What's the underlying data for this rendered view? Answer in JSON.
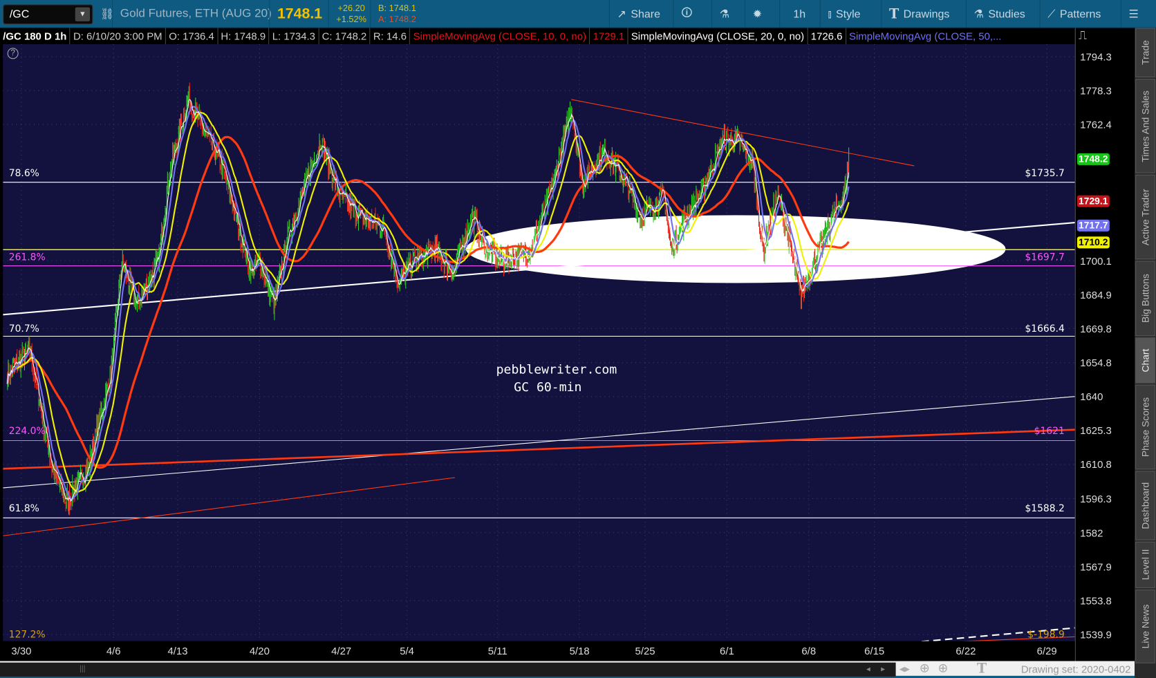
{
  "toolbar": {
    "symbol": "/GC",
    "description": "Gold Futures, ETH (AUG 20)",
    "last": "1748.1",
    "change": "+26.20",
    "change_pct": "+1.52%",
    "bid": "B: 1748.1",
    "ask": "A: 1748.2",
    "share": "Share",
    "timeframe": "1h",
    "style": "Style",
    "drawings": "Drawings",
    "studies": "Studies",
    "patterns": "Patterns"
  },
  "infobar": {
    "title": "/GC 180 D 1h",
    "date": "D: 6/10/20 3:00 PM",
    "open": "O: 1736.4",
    "high": "H: 1748.9",
    "low": "L: 1734.3",
    "close": "C: 1748.2",
    "range": "R: 14.6",
    "sma10": "SimpleMovingAvg (CLOSE, 10, 0, no)",
    "sma10_val": "1729.1",
    "sma20": "SimpleMovingAvg (CLOSE, 20, 0, no)",
    "sma20_val": "1726.6",
    "sma50": "SimpleMovingAvg (CLOSE, 50,..."
  },
  "chart_data": {
    "type": "line",
    "title": "/GC 180 D 1h",
    "scale": "log",
    "x_ticks": [
      "3/30",
      "4/6",
      "4/13",
      "4/20",
      "4/27",
      "5/4",
      "5/11",
      "5/18",
      "5/25",
      "6/1",
      "6/8",
      "6/15",
      "6/22",
      "6/29"
    ],
    "y_ticks": [
      "1794.3",
      "1778.3",
      "1762.4",
      "1748.2",
      "1729.1",
      "1717.7",
      "1710.2",
      "1700.1",
      "1684.9",
      "1669.8",
      "1654.8",
      "1640",
      "1625.3",
      "1610.8",
      "1596.3",
      "1582",
      "1567.9",
      "1553.8",
      "1539.9"
    ],
    "y_range": [
      1539.9,
      1794.3
    ],
    "price_path_weeks_price": [
      [
        -0.15,
        1650
      ],
      [
        0.09,
        1660
      ],
      [
        0.33,
        1610
      ],
      [
        0.49,
        1595
      ],
      [
        0.73,
        1610
      ],
      [
        0.97,
        1650
      ],
      [
        1.13,
        1700
      ],
      [
        1.36,
        1680
      ],
      [
        1.7,
        1700
      ],
      [
        1.87,
        1740
      ],
      [
        2.13,
        1775
      ],
      [
        2.31,
        1760
      ],
      [
        2.53,
        1745
      ],
      [
        2.71,
        1720
      ],
      [
        2.89,
        1695
      ],
      [
        3.0,
        1700
      ],
      [
        3.18,
        1680
      ],
      [
        3.34,
        1710
      ],
      [
        3.61,
        1740
      ],
      [
        3.75,
        1755
      ],
      [
        3.97,
        1730
      ],
      [
        4.3,
        1720
      ],
      [
        4.64,
        1715
      ],
      [
        4.87,
        1690
      ],
      [
        5.07,
        1700
      ],
      [
        5.31,
        1705
      ],
      [
        5.51,
        1695
      ],
      [
        5.72,
        1720
      ],
      [
        5.88,
        1705
      ],
      [
        6.05,
        1700
      ],
      [
        6.41,
        1705
      ],
      [
        6.68,
        1735
      ],
      [
        6.9,
        1770
      ],
      [
        7.04,
        1735
      ],
      [
        7.38,
        1750
      ],
      [
        7.72,
        1735
      ],
      [
        7.94,
        1720
      ],
      [
        8.23,
        1730
      ],
      [
        8.32,
        1705
      ],
      [
        8.5,
        1720
      ],
      [
        8.68,
        1730
      ],
      [
        8.95,
        1755
      ],
      [
        9.13,
        1755
      ],
      [
        9.31,
        1745
      ],
      [
        9.44,
        1705
      ],
      [
        9.62,
        1730
      ],
      [
        9.76,
        1710
      ],
      [
        9.89,
        1685
      ],
      [
        10.03,
        1695
      ],
      [
        10.37,
        1720
      ],
      [
        10.54,
        1730
      ],
      [
        10.62,
        1748.2
      ]
    ],
    "price_badges": [
      {
        "value": "1748.2",
        "color": "#19c419"
      },
      {
        "value": "1729.1",
        "color": "#c4141b"
      },
      {
        "value": "1717.7",
        "color": "#7272f0"
      },
      {
        "value": "1710.2",
        "color": "#f0f000"
      }
    ],
    "fib_levels": [
      {
        "pct": "78.6%",
        "price": "$1735.7",
        "level": 1735.7,
        "color": "#ffffff"
      },
      {
        "pct": "261.8%",
        "price": "$1697.7",
        "level": 1697.7,
        "color": "#ff55ff"
      },
      {
        "pct": "70.7%",
        "price": "$1666.4",
        "level": 1666.4,
        "color": "#ffffff"
      },
      {
        "pct": "224.0%",
        "price": "$1621",
        "level": 1621,
        "color": "#ff55ff"
      },
      {
        "pct": "61.8%",
        "price": "$1588.2",
        "level": 1588.2,
        "color": "#ffffff"
      },
      {
        "pct": "127.2%",
        "price": "$-198.9",
        "level": null,
        "color": "#d4a017"
      }
    ],
    "horizontal_line": 1705,
    "watermark": [
      "pebblewriter.com",
      "GC 60-min"
    ]
  },
  "sidebar": {
    "tabs": [
      "Trade",
      "Times And Sales",
      "Active Trader",
      "Big Buttons",
      "Chart",
      "Phase Scores",
      "Dashboard",
      "Level II",
      "Live News"
    ]
  },
  "bottom": {
    "drawing_set": "Drawing set: 2020-0402"
  }
}
